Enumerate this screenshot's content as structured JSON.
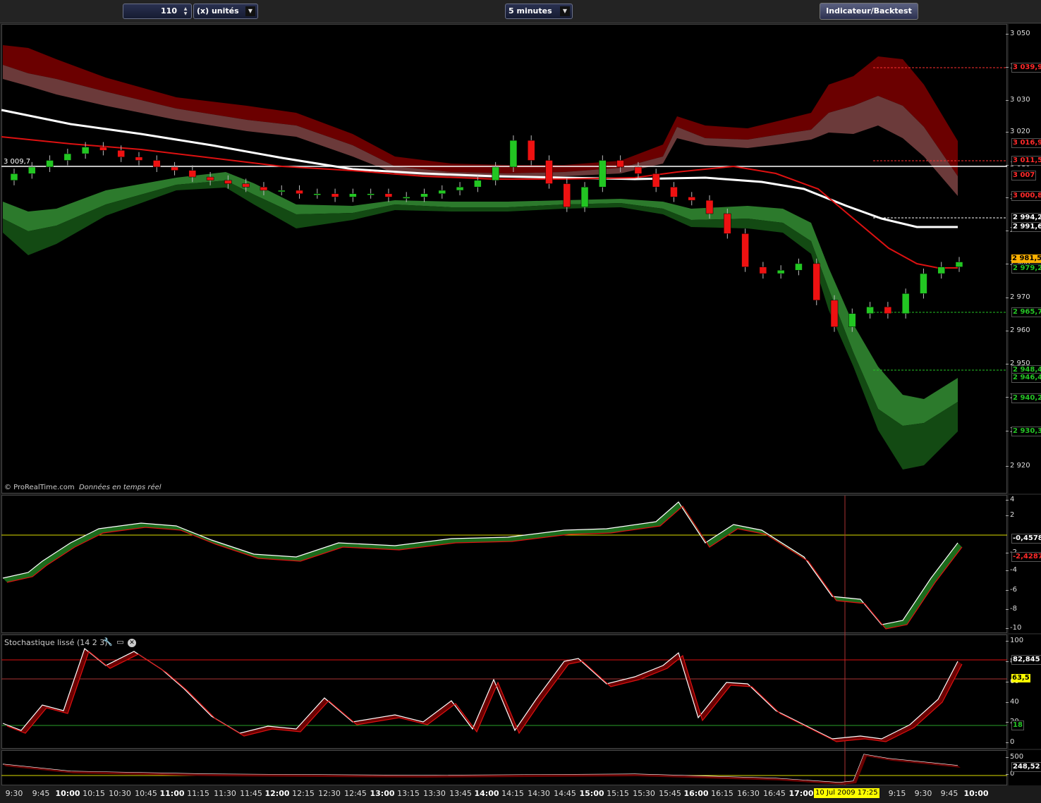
{
  "toolbar": {
    "quantity": "110",
    "units_label": "(x) unités",
    "timeframe": "5 minutes",
    "indicator_button": "Indicateur/Backtest"
  },
  "credit": {
    "brand": "© ProRealTime.com",
    "text": "Données en temps réel"
  },
  "price_axis": {
    "ticks": [
      "3 050",
      "3 040",
      "3 030",
      "3 020",
      "3 010",
      "3 000",
      "2 990",
      "2 980",
      "2 970",
      "2 960",
      "2 950",
      "2 940",
      "2 930",
      "2 920"
    ],
    "tags": [
      {
        "text": "3 039,9",
        "color": "red"
      },
      {
        "text": "3 016,9",
        "color": "red"
      },
      {
        "text": "3 011,5",
        "color": "red"
      },
      {
        "text": "3 007",
        "color": "red"
      },
      {
        "text": "3 000,8",
        "color": "red"
      },
      {
        "text": "2 994,2",
        "color": "white"
      },
      {
        "text": "2 991,6",
        "color": "white"
      },
      {
        "text": "2 981,50",
        "color": "orange"
      },
      {
        "text": "2 979,2",
        "color": "green"
      },
      {
        "text": "2 965,7",
        "color": "green"
      },
      {
        "text": "2 948,4",
        "color": "green"
      },
      {
        "text": "2 946,4",
        "color": "green"
      },
      {
        "text": "2 940,2",
        "color": "green"
      },
      {
        "text": "2 930,3",
        "color": "green"
      }
    ],
    "left_label": "3 009,7"
  },
  "osc_axis": {
    "ticks": [
      "4",
      "2",
      "-2",
      "-4",
      "-6",
      "-8",
      "-10"
    ],
    "tags": [
      {
        "text": "-0,4578",
        "color": "white"
      },
      {
        "text": "-2,4287",
        "color": "red"
      }
    ]
  },
  "stoch": {
    "title": "Stochastique lissé (14 2 3)",
    "ticks": [
      "100",
      "80",
      "60",
      "40",
      "20",
      "0"
    ],
    "tags": [
      {
        "text": "82,845",
        "color": "white"
      },
      {
        "text": "63,5",
        "color": "yellow"
      },
      {
        "text": "18",
        "color": "green"
      }
    ]
  },
  "volume": {
    "ticks": [
      "500",
      "0"
    ],
    "tags": [
      {
        "text": "248,52",
        "color": "white"
      }
    ]
  },
  "time_axis": {
    "labels": [
      {
        "t": "9:30",
        "major": false
      },
      {
        "t": "9:45",
        "major": false
      },
      {
        "t": "10:00",
        "major": true
      },
      {
        "t": "10:15",
        "major": false
      },
      {
        "t": "10:30",
        "major": false
      },
      {
        "t": "10:45",
        "major": false
      },
      {
        "t": "11:00",
        "major": true
      },
      {
        "t": "11:15",
        "major": false
      },
      {
        "t": "11:30",
        "major": false
      },
      {
        "t": "11:45",
        "major": false
      },
      {
        "t": "12:00",
        "major": true
      },
      {
        "t": "12:15",
        "major": false
      },
      {
        "t": "12:30",
        "major": false
      },
      {
        "t": "12:45",
        "major": false
      },
      {
        "t": "13:00",
        "major": true
      },
      {
        "t": "13:15",
        "major": false
      },
      {
        "t": "13:30",
        "major": false
      },
      {
        "t": "13:45",
        "major": false
      },
      {
        "t": "14:00",
        "major": true
      },
      {
        "t": "14:15",
        "major": false
      },
      {
        "t": "14:30",
        "major": false
      },
      {
        "t": "14:45",
        "major": false
      },
      {
        "t": "15:00",
        "major": true
      },
      {
        "t": "15:15",
        "major": false
      },
      {
        "t": "15:30",
        "major": false
      },
      {
        "t": "15:45",
        "major": false
      },
      {
        "t": "16:00",
        "major": true
      },
      {
        "t": "16:15",
        "major": false
      },
      {
        "t": "16:30",
        "major": false
      },
      {
        "t": "16:45",
        "major": false
      },
      {
        "t": "17:00",
        "major": true
      },
      {
        "t": "9:15",
        "major": false
      },
      {
        "t": "9:30",
        "major": false
      },
      {
        "t": "9:45",
        "major": false
      },
      {
        "t": "10:00",
        "major": true
      }
    ],
    "cursor_date": "10 Jul 2009 17:25"
  },
  "colors": {
    "up": "#22c622",
    "down": "#ee1111",
    "upper_band": "#6b0000",
    "lower_band": "#1f6b1f",
    "ma_white": "#ffffff",
    "ma_red": "#dd1111"
  },
  "chart_data": {
    "type": "candlestick",
    "price_range": [
      2915,
      3055
    ],
    "closes": [
      3008,
      3010,
      3012,
      3014,
      3016,
      3015,
      3013,
      3012,
      3010,
      3009,
      3007,
      3006,
      3005,
      3004,
      3003,
      3003,
      3002,
      3002,
      3001,
      3002,
      3002,
      3001,
      3001,
      3002,
      3003,
      3004,
      3006,
      3010,
      3018,
      3012,
      3005,
      2998,
      3004,
      3012,
      3010,
      3008,
      3004,
      3001,
      3000,
      2996,
      2990,
      2980,
      2978,
      2979,
      2981,
      2970,
      2962,
      2966,
      2968,
      2966,
      2972,
      2978,
      2980,
      2981.5
    ]
  }
}
